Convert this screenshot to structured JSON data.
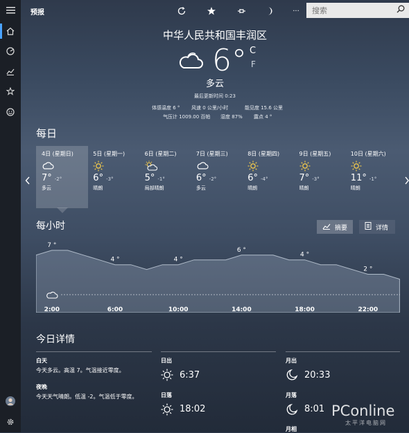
{
  "app": {
    "title": "预报"
  },
  "toolbar": {
    "refresh_icon": "refresh-icon",
    "favorite_icon": "star-icon",
    "pin_icon": "pin-icon",
    "theme_icon": "moon-icon",
    "more_label": "···",
    "search_placeholder": "搜索"
  },
  "sidebar": {
    "items": [
      "home-icon",
      "radar-icon",
      "chart-icon",
      "favorites-icon",
      "smiley-icon",
      "avatar",
      "settings-icon"
    ]
  },
  "current": {
    "location": "中华人民共和国丰润区",
    "temperature": "6°",
    "unit_c": "C",
    "unit_f": "F",
    "condition": "多云",
    "updated": "最后更新时间 0:23",
    "feels_like": "体感温度  6 °",
    "wind": "风速    0 公里/小时",
    "visibility": "能见度  15.6 公里",
    "pressure": "气压计  1009.00 百帕",
    "humidity": "湿度  87%",
    "dewpoint": "露点  4 °"
  },
  "daily": {
    "title": "每日",
    "days": [
      {
        "name": "4日 (星期日)",
        "hi": "7°",
        "lo": "-2°",
        "cond": "多云",
        "icon": "cloudy"
      },
      {
        "name": "5日 (星期一)",
        "hi": "6°",
        "lo": "-3°",
        "cond": "晴朗",
        "icon": "sunny"
      },
      {
        "name": "6日 (星期二)",
        "hi": "5°",
        "lo": "-1°",
        "cond": "局部晴朗",
        "icon": "partly"
      },
      {
        "name": "7日 (星期三)",
        "hi": "6°",
        "lo": "-2°",
        "cond": "多云",
        "icon": "cloudy"
      },
      {
        "name": "8日 (星期四)",
        "hi": "6°",
        "lo": "-4°",
        "cond": "晴朗",
        "icon": "sunny"
      },
      {
        "name": "9日 (星期五)",
        "hi": "7°",
        "lo": "-3°",
        "cond": "晴朗",
        "icon": "sunny"
      },
      {
        "name": "10日 (星期六)",
        "hi": "11°",
        "lo": "-1°",
        "cond": "晴朗",
        "icon": "sunny"
      }
    ]
  },
  "hourly": {
    "title": "每小时",
    "summary_label": "摘要",
    "details_label": "详情",
    "x_labels": [
      "2:00",
      "6:00",
      "10:00",
      "14:00",
      "18:00",
      "22:00"
    ]
  },
  "chart_data": {
    "type": "area",
    "x": [
      1,
      2,
      3,
      4,
      5,
      6,
      7,
      8,
      9,
      10,
      11,
      12,
      13,
      14,
      15,
      16,
      17,
      18,
      19,
      20,
      21,
      22,
      23,
      24
    ],
    "values": [
      6,
      7,
      7,
      6,
      5,
      4,
      4,
      3,
      4,
      4,
      5,
      5,
      5,
      6,
      6,
      6,
      5,
      5,
      4,
      4,
      3,
      2,
      2,
      1
    ],
    "point_labels": [
      {
        "x": 2,
        "label": "7 °"
      },
      {
        "x": 6,
        "label": "4 °"
      },
      {
        "x": 10,
        "label": "4 °"
      },
      {
        "x": 14,
        "label": "6 °"
      },
      {
        "x": 18,
        "label": "4 °"
      },
      {
        "x": 22,
        "label": "2 °"
      }
    ],
    "ylim": [
      -6,
      9
    ]
  },
  "today": {
    "title": "今日详情",
    "day_label": "白天",
    "day_text": "今天多云。高温 7。气温接近零度。",
    "night_label": "夜晚",
    "night_text": "今天天气晴朗。低温 -2。气温低于零度。",
    "sunrise_label": "日出",
    "sunrise": "6:37",
    "sunset_label": "日落",
    "sunset": "18:02",
    "moonrise_label": "月出",
    "moonrise": "20:33",
    "moonset_label": "月落",
    "moonset": "8:01",
    "moonphase_label": "月相"
  },
  "watermark": {
    "text": "PConline",
    "sub": "太平洋电脑网"
  }
}
